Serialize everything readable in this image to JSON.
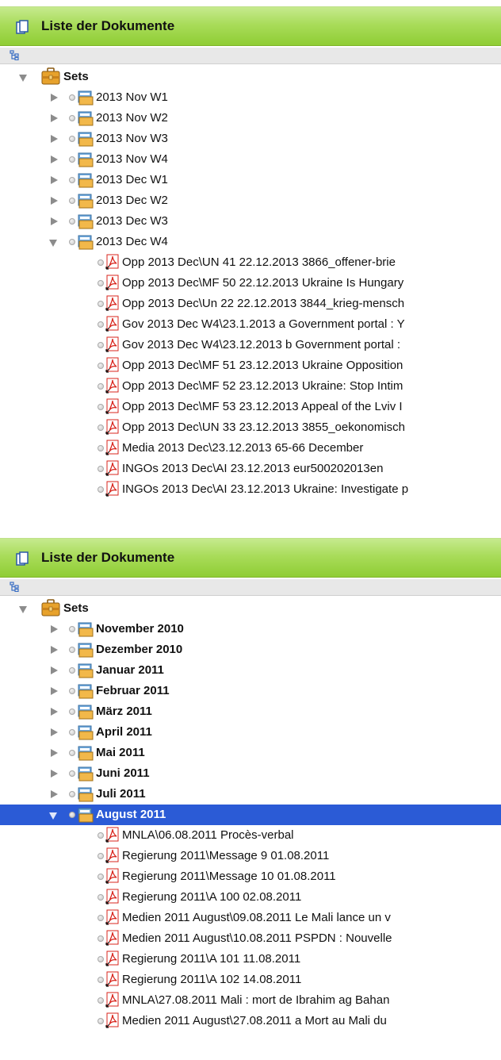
{
  "panels": [
    {
      "title": "Liste der Dokumente",
      "root": {
        "label": "Sets",
        "icon": "briefcase-icon"
      },
      "sets": [
        "2013 Nov W1",
        "2013 Nov W2",
        "2013 Nov W3",
        "2013 Nov W4",
        "2013 Dec W1",
        "2013 Dec W2",
        "2013 Dec W3",
        "2013 Dec W4"
      ],
      "expanded_set": "2013 Dec W4",
      "documents": [
        "Opp 2013 Dec\\UN 41 22.12.2013  3866_offener-brie",
        "Opp 2013 Dec\\MF 50 22.12.2013 Ukraine Is Hungary",
        "Opp 2013 Dec\\Un 22 22.12.2013 3844_krieg-mensch",
        "Gov 2013 Dec W4\\23.1.2013 a Government portal : Y",
        "Gov 2013 Dec W4\\23.12.2013 b Government portal :",
        "Opp 2013 Dec\\MF 51 23.12.2013 Ukraine Opposition",
        "Opp 2013 Dec\\MF 52 23.12.2013 Ukraine: Stop Intim",
        "Opp 2013 Dec\\MF 53 23.12.2013 Appeal of the Lviv I",
        "Opp 2013 Dec\\UN 33 23.12.2013 3855_oekonomisch",
        "Media 2013 Dec\\23.12.2013 65-66 December",
        "INGOs 2013 Dec\\AI 23.12.2013 eur500202013en",
        "INGOs 2013 Dec\\AI 23.12.2013 Ukraine: Investigate p"
      ]
    },
    {
      "title": "Liste der Dokumente",
      "root": {
        "label": "Sets",
        "icon": "briefcase-icon"
      },
      "sets": [
        "November 2010",
        "Dezember 2010",
        "Januar 2011",
        "Februar 2011",
        "März 2011",
        "April 2011",
        "Mai 2011",
        "Juni 2011",
        "Juli 2011",
        "August 2011"
      ],
      "expanded_set": "August 2011",
      "selected_set": "August 2011",
      "documents": [
        "MNLA\\06.08.2011 Procès-verbal",
        "Regierung 2011\\Message 9 01.08.2011",
        "Regierung 2011\\Message 10 01.08.2011",
        "Regierung 2011\\A 100 02.08.2011",
        "Medien 2011 August\\09.08.2011 Le Mali lance un v",
        "Medien 2011 August\\10.08.2011 PSPDN : Nouvelle",
        "Regierung 2011\\A 101 11.08.2011",
        "Regierung 2011\\A 102 14.08.2011",
        "MNLA\\27.08.2011 Mali : mort de Ibrahim ag Bahan",
        "Medien 2011 August\\27.08.2011 a Mort au Mali du"
      ]
    }
  ],
  "colors": {
    "title_bar": "#a9dc5a",
    "selection": "#2b5bd6",
    "pdf_icon": "#d8241c"
  }
}
